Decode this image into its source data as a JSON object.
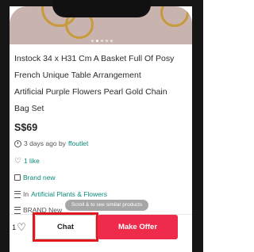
{
  "listing": {
    "title_lines": [
      "Instock 34 x H31 Cm A Basket Full Of Posy",
      "French Unique Table Arrangement",
      "Artificial Purple Flowers Pearl Gold Chain",
      "Bag Set"
    ],
    "price": "S$69",
    "posted_prefix": "3 days ago by ",
    "seller": "ffoutlet",
    "likes_text": "1 like",
    "condition": "Brand new",
    "category_prefix": "In ",
    "category": "Artificial Plants & Flowers",
    "brand_text": "BRAND New"
  },
  "tooltip": "Scroll & to see similar products",
  "bottom_bar": {
    "like_count": "1",
    "chat_label": "Chat",
    "offer_label": "Make Offer"
  },
  "colors": {
    "accent_link": "#0a8a7a",
    "offer_button": "#ef2b4b",
    "highlight_box": "#e0171d"
  },
  "icons": [
    "clock-icon",
    "heart-icon",
    "tag-icon",
    "list-icon"
  ]
}
